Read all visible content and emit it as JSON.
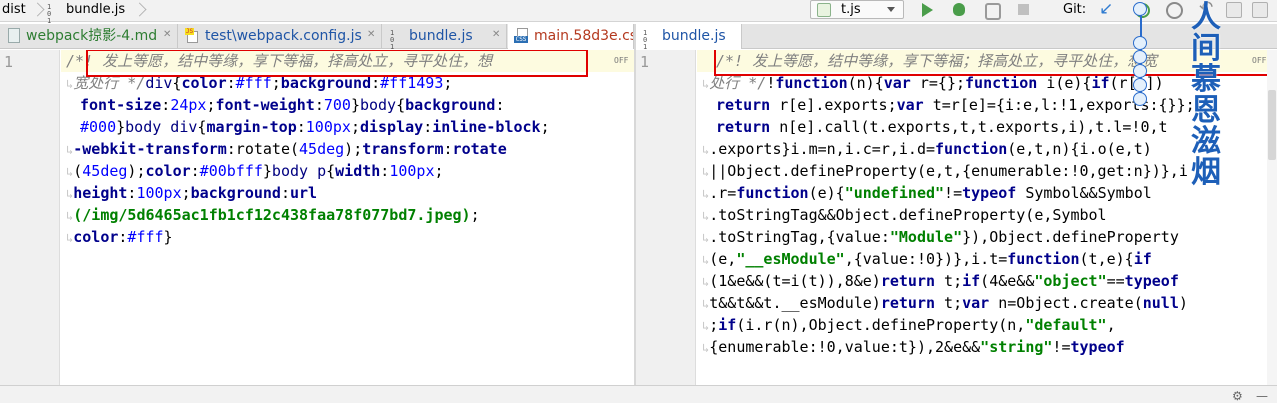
{
  "breadcrumb": {
    "root": "dist",
    "file": "bundle.js"
  },
  "run_config": {
    "label": "t.js"
  },
  "vcs": {
    "label": "Git:"
  },
  "left_tabs": [
    {
      "label": "webpack掠影-4.md",
      "kind": "md"
    },
    {
      "label": "test\\webpack.config.js",
      "kind": "js"
    },
    {
      "label": "bundle.js",
      "kind": "bin"
    },
    {
      "label": "main.58d3e.css",
      "kind": "css"
    }
  ],
  "right_tabs": [
    {
      "label": "bundle.js",
      "kind": "bin"
    }
  ],
  "left_editor": {
    "line_number": "1",
    "off_label": "OFF",
    "lines": [
      "/*! 发上等愿，结中等缘，享下等福，择高处立，寻平处住，想",
      "宽处行 */div{color:#fff;background:#ff1493;",
      "font-size:24px;font-weight:700}body{background:",
      "#000}body div{margin-top:100px;display:inline-block;",
      "-webkit-transform:rotate(45deg);transform:rotate",
      "(45deg);color:#00bfff}body p{width:100px;",
      "height:100px;background:url",
      "(/img/5d6465ac1fb1cf12c438faa78f077bd7.jpeg);",
      "color:#fff}"
    ]
  },
  "right_editor": {
    "line_number": "1",
    "off_label": "OFF",
    "lines": [
      "/*! 发上等愿，结中等缘，享下等福；择高处立，寻平处住，想宽",
      "处行 */!function(n){var r={};function i(e){if(r[e])",
      "return r[e].exports;var t=r[e]={i:e,l:!1,exports:{}};",
      "return n[e].call(t.exports,t,t.exports,i),t.l=!0,t",
      ".exports}i.m=n,i.c=r,i.d=function(e,t,n){i.o(e,t)",
      "||Object.defineProperty(e,t,{enumerable:!0,get:n})},i",
      ".r=function(e){\"undefined\"!=typeof Symbol&&Symbol",
      ".toStringTag&&Object.defineProperty(e,Symbol",
      ".toStringTag,{value:\"Module\"}),Object.defineProperty",
      "(e,\"__esModule\",{value:!0})},i.t=function(t,e){if",
      "(1&e&&(t=i(t)),8&e)return t;if(4&e&&\"object\"==typeof",
      "t&&t&&t.__esModule)return t;var n=Object.create(null)",
      ";if(i.r(n),Object.defineProperty(n,\"default\",",
      "{enumerable:!0,value:t}),2&e&&\"string\"!=typeof"
    ]
  },
  "overlay": {
    "vertical_text": "人间慕恩滋烟"
  },
  "colors": {
    "highlight_box": "#e00000",
    "keyword": "#00008b",
    "number": "#0000ff",
    "string": "#008000",
    "comment": "#808080"
  }
}
